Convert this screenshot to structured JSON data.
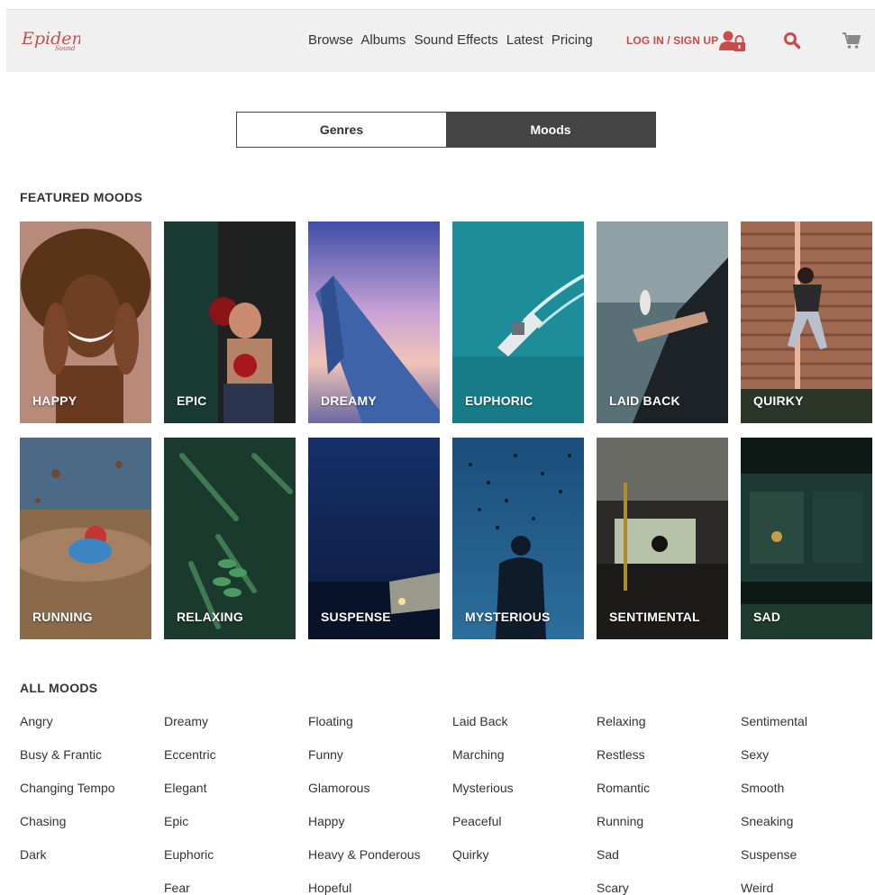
{
  "header": {
    "logo_text": "Epidemic Sound",
    "nav": [
      "Browse",
      "Albums",
      "Sound Effects",
      "Latest",
      "Pricing"
    ],
    "login_label": "LOG IN / SIGN UP",
    "accent_color": "#c94b4b"
  },
  "toggle": {
    "genres": "Genres",
    "moods": "Moods"
  },
  "featured": {
    "title": "FEATURED MOODS",
    "tiles": [
      "HAPPY",
      "EPIC",
      "DREAMY",
      "EUPHORIC",
      "LAID BACK",
      "QUIRKY",
      "RUNNING",
      "RELAXING",
      "SUSPENSE",
      "MYSTERIOUS",
      "SENTIMENTAL",
      "SAD"
    ]
  },
  "all_moods": {
    "title": "ALL MOODS",
    "columns": [
      [
        "Angry",
        "Busy & Frantic",
        "Changing Tempo",
        "Chasing",
        "Dark"
      ],
      [
        "Dreamy",
        "Eccentric",
        "Elegant",
        "Epic",
        "Euphoric",
        "Fear"
      ],
      [
        "Floating",
        "Funny",
        "Glamorous",
        "Happy",
        "Heavy & Ponderous",
        "Hopeful"
      ],
      [
        "Laid Back",
        "Marching",
        "Mysterious",
        "Peaceful",
        "Quirky"
      ],
      [
        "Relaxing",
        "Restless",
        "Romantic",
        "Running",
        "Sad",
        "Scary"
      ],
      [
        "Sentimental",
        "Sexy",
        "Smooth",
        "Sneaking",
        "Suspense",
        "Weird"
      ]
    ]
  }
}
